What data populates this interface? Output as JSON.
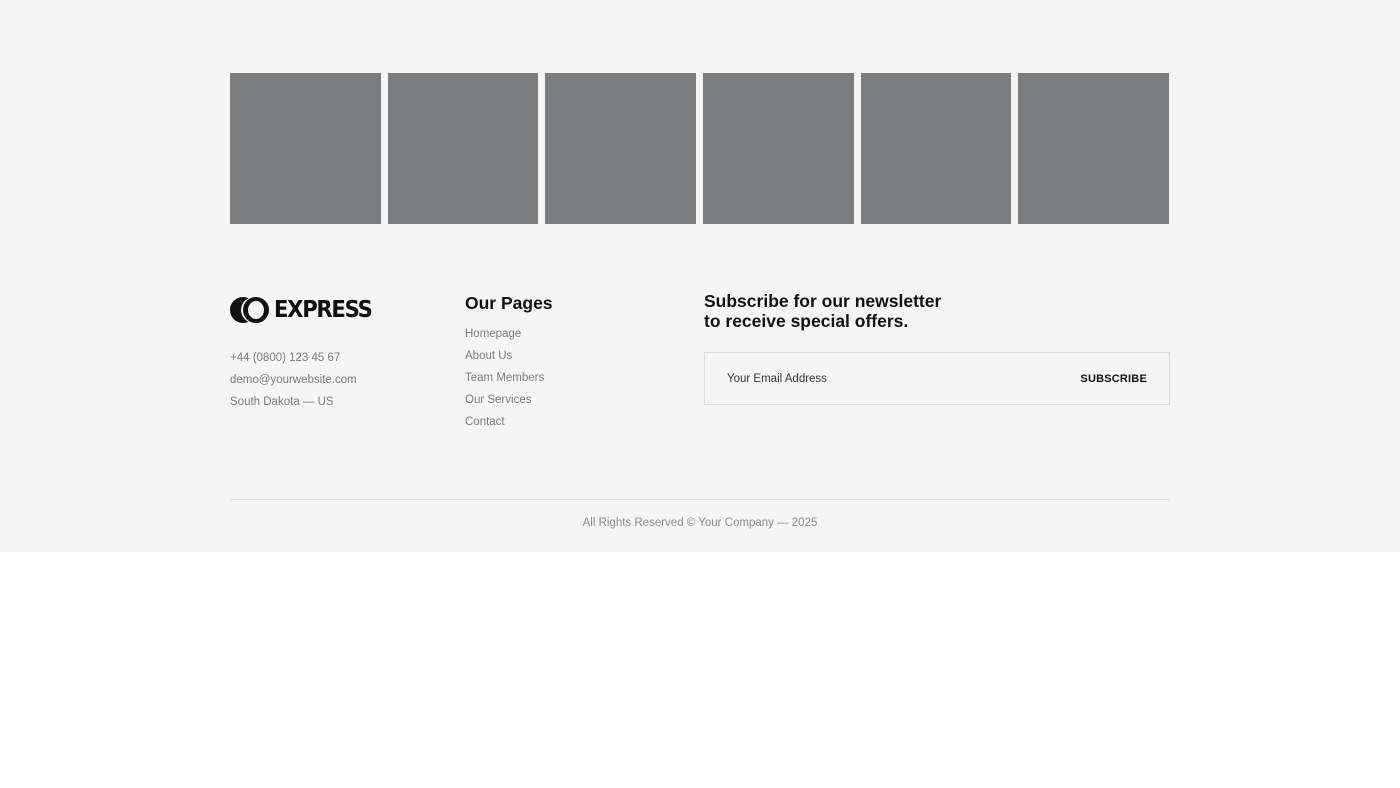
{
  "gallery": {
    "tiles": [
      "",
      "",
      "",
      "",
      "",
      ""
    ]
  },
  "brand": {
    "logo_text": "EXPRESS",
    "phone": "+44 (0800) 123 45 67",
    "email": "demo@yourwebsite.com",
    "location": "South Dakota — US"
  },
  "pages": {
    "title": "Our Pages",
    "items": [
      {
        "label": "Homepage"
      },
      {
        "label": "About Us"
      },
      {
        "label": "Team Members"
      },
      {
        "label": "Our Services"
      },
      {
        "label": "Contact"
      }
    ]
  },
  "newsletter": {
    "title": "Subscribe for our newsletter to receive special offers.",
    "email_placeholder": "Your Email Address",
    "email_value": "",
    "subscribe_label": "SUBSCRIBE"
  },
  "footer": {
    "copyright": "All Rights Reserved © Your Company — 2025"
  },
  "colors": {
    "background": "#f5f5f5",
    "tile": "#7b7c7d",
    "text_primary": "#111111",
    "text_muted": "#7a7a7a"
  }
}
